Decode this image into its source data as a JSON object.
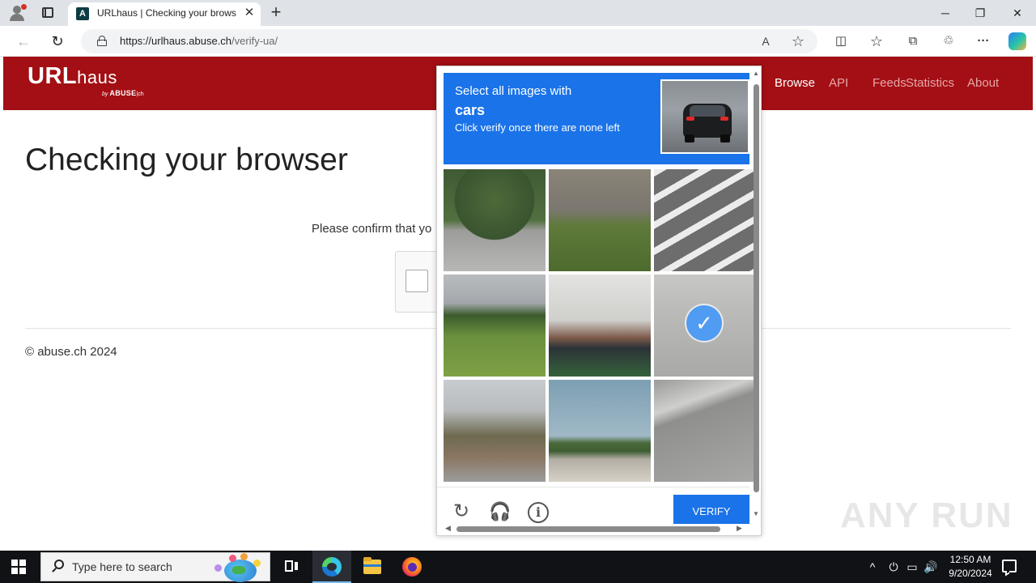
{
  "browser": {
    "tab_title": "URLhaus | Checking your browser",
    "tab_favicon_glyph": "A",
    "tab_close_glyph": "✕",
    "new_tab_glyph": "+",
    "window_minimize": "─",
    "window_restore": "❐",
    "window_close": "✕",
    "url_host": "https://urlhaus.abuse.ch",
    "url_path": "/verify-ua/",
    "back_glyph": "←",
    "reload_glyph": "↻",
    "read_aloud_glyph": "A",
    "favorite_glyph": "☆",
    "split_glyph": "◫",
    "favorites_glyph": "☆",
    "collections_glyph": "⧉",
    "extensions_glyph": "♲",
    "menu_glyph": "···"
  },
  "site": {
    "logo_main": "URL",
    "logo_light": "haus",
    "logo_by": "by",
    "logo_abuse": "ABUSE",
    "logo_ch": "|ch",
    "nav": [
      {
        "label": "Browse",
        "active": true
      },
      {
        "label": "API",
        "active": false
      },
      {
        "label": "Feeds",
        "active": false
      },
      {
        "label": "Statistics",
        "active": false
      },
      {
        "label": "About",
        "active": false
      }
    ],
    "page_title": "Checking your browser",
    "confirm_text": "Please confirm that yo",
    "footer": "© abuse.ch 2024",
    "colors": {
      "header": "#a30f14",
      "accent": "#1a73e8"
    }
  },
  "captcha": {
    "prompt_line1": "Select all images with",
    "prompt_line2": "cars",
    "prompt_line3": "Click verify once there are none left",
    "tiles": [
      {
        "id": 1,
        "selected": false
      },
      {
        "id": 2,
        "selected": false
      },
      {
        "id": 3,
        "selected": false
      },
      {
        "id": 4,
        "selected": false
      },
      {
        "id": 5,
        "selected": false
      },
      {
        "id": 6,
        "selected": true
      },
      {
        "id": 7,
        "selected": false
      },
      {
        "id": 8,
        "selected": false
      },
      {
        "id": 9,
        "selected": false
      }
    ],
    "check_glyph": "✓",
    "reload_glyph": "↻",
    "audio_glyph": "🎧",
    "info_glyph": "i",
    "verify_label": "VERIFY",
    "icons": [
      "reload-icon",
      "headphones-icon",
      "info-icon"
    ]
  },
  "watermark": "ANY RUN",
  "taskbar": {
    "search_placeholder": "Type here to search",
    "time": "12:50 AM",
    "date": "9/20/2024",
    "tray_chevron": "^",
    "tray_network": "▭",
    "tray_volume": "🔊",
    "tray_usb": "⏻"
  }
}
